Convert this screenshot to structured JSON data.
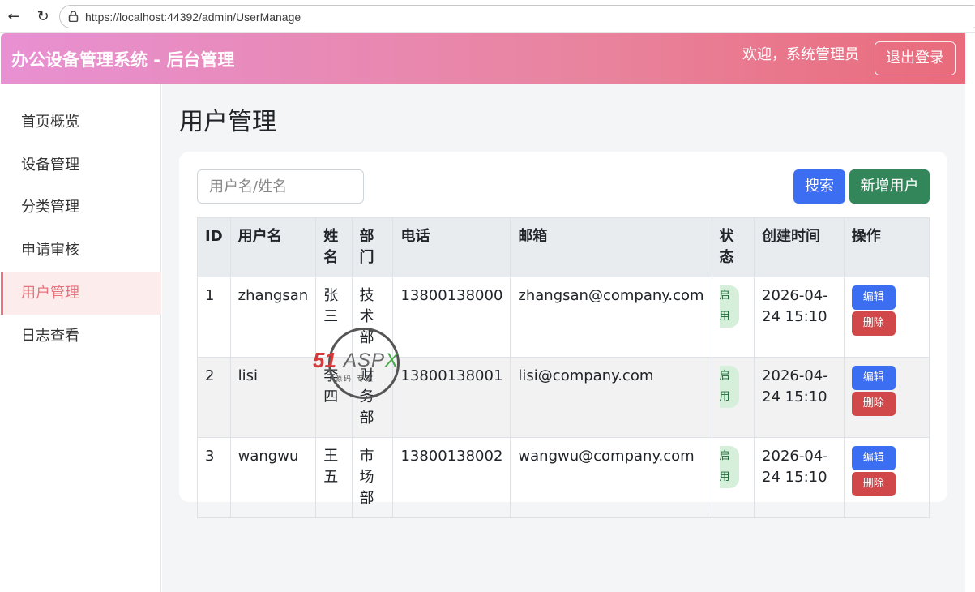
{
  "browser": {
    "url": "https://localhost:44392/admin/UserManage"
  },
  "header": {
    "title": "办公设备管理系统 - 后台管理",
    "welcome": "欢迎，系统管理员",
    "logout_label": "退出登录"
  },
  "sidebar": {
    "items": [
      {
        "label": "首页概览"
      },
      {
        "label": "设备管理"
      },
      {
        "label": "分类管理"
      },
      {
        "label": "申请审核"
      },
      {
        "label": "用户管理",
        "active": true
      },
      {
        "label": "日志查看"
      }
    ]
  },
  "main": {
    "title": "用户管理",
    "search_placeholder": "用户名/姓名",
    "search_label": "搜索",
    "add_label": "新增用户",
    "columns": [
      "ID",
      "用户名",
      "姓名",
      "部门",
      "电话",
      "邮箱",
      "状态",
      "创建时间",
      "操作"
    ],
    "rows": [
      {
        "id": "1",
        "username": "zhangsan",
        "name": "张三",
        "dept": "技术部",
        "phone": "13800138000",
        "email": "zhangsan@company.com",
        "status": "启用",
        "created": "2026-04-24 15:10",
        "edit": "编辑",
        "delete": "删除"
      },
      {
        "id": "2",
        "username": "lisi",
        "name": "李四",
        "dept": "财务部",
        "phone": "13800138001",
        "email": "lisi@company.com",
        "status": "启用",
        "created": "2026-04-24 15:10",
        "edit": "编辑",
        "delete": "删除"
      },
      {
        "id": "3",
        "username": "wangwu",
        "name": "王五",
        "dept": "市场部",
        "phone": "13800138002",
        "email": "wangwu@company.com",
        "status": "启用",
        "created": "2026-04-24 15:10",
        "edit": "编辑",
        "delete": "删除"
      }
    ]
  },
  "watermark": {
    "brand_51": "51",
    "brand_asp": "ASP",
    "brand_x": "X",
    "tagline": "源码 专家"
  },
  "colors": {
    "header_gradient_start": "#e890d2",
    "header_gradient_end": "#e96b7b",
    "accent": "#e8727d",
    "primary": "#3c6ef2",
    "success": "#33855a",
    "danger": "#d0484a"
  }
}
